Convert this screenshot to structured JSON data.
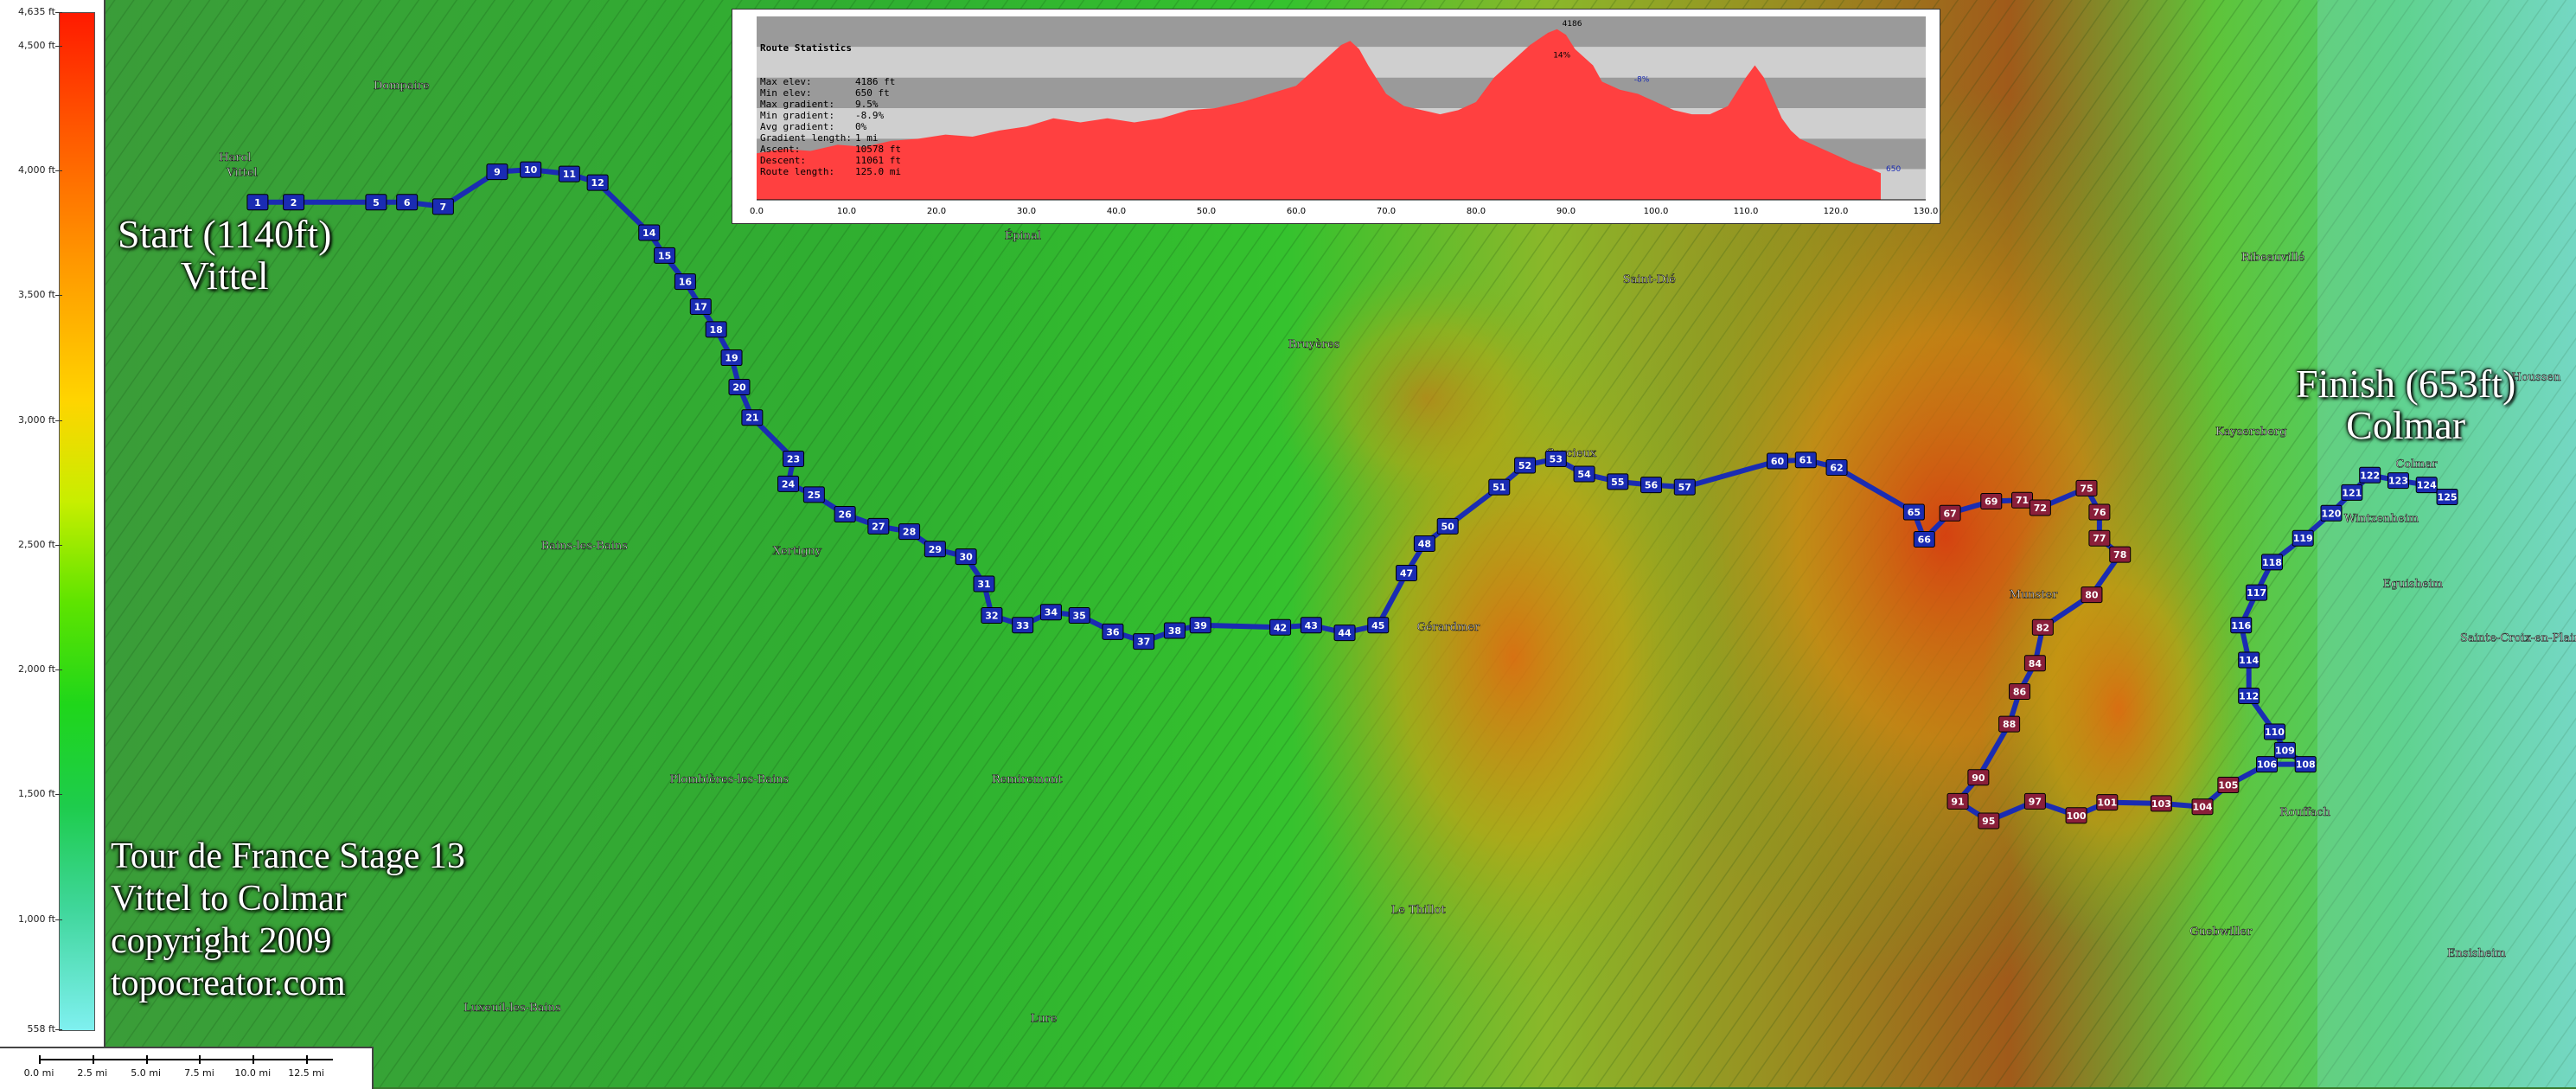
{
  "elevation_legend": {
    "ticks": [
      "4,635 ft",
      "4,500 ft",
      "4,000 ft",
      "3,500 ft",
      "3,000 ft",
      "2,500 ft",
      "2,000 ft",
      "1,500 ft",
      "1,000 ft",
      "558 ft"
    ],
    "tick_values": [
      4635,
      4500,
      4000,
      3500,
      3000,
      2500,
      2000,
      1500,
      1000,
      558
    ]
  },
  "scale": {
    "labels": [
      "0.0 mi",
      "2.5 mi",
      "5.0 mi",
      "7.5 mi",
      "10.0 mi",
      "12.5 mi"
    ]
  },
  "start_label": {
    "line1": "Start (1140ft)",
    "line2": "Vittel"
  },
  "finish_label": {
    "line1": "Finish (653ft)",
    "line2": "Colmar"
  },
  "info": {
    "line1": "Tour de France Stage 13",
    "line2": "Vittel to Colmar",
    "line3": "copyright 2009",
    "line4": "topocreator.com"
  },
  "route_stats": {
    "title": "Route Statistics",
    "rows": [
      {
        "label": "Max elev:",
        "value": "4186 ft"
      },
      {
        "label": "Min elev:",
        "value": "650 ft"
      },
      {
        "label": "Max gradient:",
        "value": "9.5%"
      },
      {
        "label": "Min gradient:",
        "value": "-8.9%"
      },
      {
        "label": "Avg gradient:",
        "value": "0%"
      },
      {
        "label": "Gradient length:",
        "value": "1 mi"
      },
      {
        "label": "Ascent:",
        "value": "10578 ft"
      },
      {
        "label": "Descent:",
        "value": "11061 ft"
      },
      {
        "label": "Route length:",
        "value": "125.0 mi"
      }
    ],
    "annotations": [
      "4186",
      "14%",
      "-8%",
      "650"
    ]
  },
  "chart_data": {
    "type": "area",
    "x_tick_labels": [
      "0.0",
      "10.0",
      "20.0",
      "30.0",
      "40.0",
      "50.0",
      "60.0",
      "70.0",
      "80.0",
      "90.0",
      "100.0",
      "110.0",
      "120.0",
      "130.0"
    ],
    "xlim": [
      0,
      130
    ],
    "ylim": [
      0,
      4500
    ],
    "x": [
      0,
      3,
      6,
      9,
      12,
      15,
      18,
      21,
      24,
      27,
      30,
      33,
      36,
      39,
      42,
      45,
      48,
      51,
      54,
      57,
      60,
      62,
      64,
      65,
      66,
      67,
      68,
      70,
      72,
      74,
      76,
      78,
      80,
      82,
      84,
      86,
      88,
      89,
      90,
      91,
      92,
      93,
      94,
      96,
      98,
      100,
      102,
      104,
      106,
      108,
      110,
      111,
      112,
      113,
      114,
      115,
      116,
      118,
      120,
      122,
      124,
      125
    ],
    "y": [
      1140,
      1250,
      1200,
      1350,
      1300,
      1450,
      1500,
      1600,
      1550,
      1700,
      1800,
      2000,
      1900,
      2000,
      1900,
      2000,
      2200,
      2250,
      2400,
      2600,
      2800,
      3200,
      3600,
      3800,
      3900,
      3700,
      3300,
      2600,
      2300,
      2200,
      2100,
      2200,
      2400,
      3000,
      3400,
      3800,
      4100,
      4186,
      4050,
      3700,
      3500,
      3300,
      2900,
      2700,
      2600,
      2400,
      2200,
      2100,
      2100,
      2300,
      3000,
      3300,
      3000,
      2500,
      2000,
      1700,
      1500,
      1300,
      1100,
      900,
      750,
      653
    ],
    "series_color": "#ff4040",
    "bands": [
      "#9a9a9a",
      "#cfcfcf"
    ]
  },
  "route": {
    "color": "#1a2cb3",
    "markers": [
      {
        "n": "1",
        "mx": 0.1,
        "my": 0.186
      },
      {
        "n": "2",
        "mx": 0.114,
        "my": 0.186
      },
      {
        "n": "5",
        "mx": 0.146,
        "my": 0.186
      },
      {
        "n": "6",
        "mx": 0.158,
        "my": 0.186
      },
      {
        "n": "7",
        "mx": 0.172,
        "my": 0.19
      },
      {
        "n": "9",
        "mx": 0.193,
        "my": 0.158
      },
      {
        "n": "10",
        "mx": 0.206,
        "my": 0.156
      },
      {
        "n": "11",
        "mx": 0.221,
        "my": 0.16
      },
      {
        "n": "12",
        "mx": 0.232,
        "my": 0.168
      },
      {
        "n": "14",
        "mx": 0.252,
        "my": 0.214
      },
      {
        "n": "15",
        "mx": 0.258,
        "my": 0.235
      },
      {
        "n": "16",
        "mx": 0.266,
        "my": 0.259
      },
      {
        "n": "17",
        "mx": 0.272,
        "my": 0.282
      },
      {
        "n": "18",
        "mx": 0.278,
        "my": 0.303
      },
      {
        "n": "19",
        "mx": 0.284,
        "my": 0.329
      },
      {
        "n": "20",
        "mx": 0.287,
        "my": 0.356
      },
      {
        "n": "21",
        "mx": 0.292,
        "my": 0.384
      },
      {
        "n": "23",
        "mx": 0.308,
        "my": 0.422
      },
      {
        "n": "24",
        "mx": 0.306,
        "my": 0.445
      },
      {
        "n": "25",
        "mx": 0.316,
        "my": 0.455
      },
      {
        "n": "26",
        "mx": 0.328,
        "my": 0.473
      },
      {
        "n": "27",
        "mx": 0.341,
        "my": 0.484
      },
      {
        "n": "28",
        "mx": 0.353,
        "my": 0.489
      },
      {
        "n": "29",
        "mx": 0.363,
        "my": 0.505
      },
      {
        "n": "30",
        "mx": 0.375,
        "my": 0.512
      },
      {
        "n": "31",
        "mx": 0.382,
        "my": 0.537
      },
      {
        "n": "32",
        "mx": 0.385,
        "my": 0.566
      },
      {
        "n": "33",
        "mx": 0.397,
        "my": 0.575
      },
      {
        "n": "34",
        "mx": 0.408,
        "my": 0.563
      },
      {
        "n": "35",
        "mx": 0.419,
        "my": 0.566
      },
      {
        "n": "36",
        "mx": 0.432,
        "my": 0.581
      },
      {
        "n": "37",
        "mx": 0.444,
        "my": 0.59
      },
      {
        "n": "38",
        "mx": 0.456,
        "my": 0.58
      },
      {
        "n": "39",
        "mx": 0.466,
        "my": 0.575
      },
      {
        "n": "42",
        "mx": 0.497,
        "my": 0.577
      },
      {
        "n": "43",
        "mx": 0.509,
        "my": 0.575
      },
      {
        "n": "44",
        "mx": 0.522,
        "my": 0.582
      },
      {
        "n": "45",
        "mx": 0.535,
        "my": 0.575
      },
      {
        "n": "47",
        "mx": 0.546,
        "my": 0.527
      },
      {
        "n": "48",
        "mx": 0.553,
        "my": 0.5
      },
      {
        "n": "50",
        "mx": 0.562,
        "my": 0.484
      },
      {
        "n": "51",
        "mx": 0.582,
        "my": 0.448
      },
      {
        "n": "52",
        "mx": 0.592,
        "my": 0.428
      },
      {
        "n": "53",
        "mx": 0.604,
        "my": 0.422
      },
      {
        "n": "54",
        "mx": 0.615,
        "my": 0.436
      },
      {
        "n": "55",
        "mx": 0.628,
        "my": 0.443
      },
      {
        "n": "56",
        "mx": 0.641,
        "my": 0.446
      },
      {
        "n": "57",
        "mx": 0.654,
        "my": 0.448
      },
      {
        "n": "60",
        "mx": 0.69,
        "my": 0.424
      },
      {
        "n": "61",
        "mx": 0.701,
        "my": 0.423
      },
      {
        "n": "62",
        "mx": 0.713,
        "my": 0.43
      },
      {
        "n": "65",
        "mx": 0.743,
        "my": 0.471
      },
      {
        "n": "66",
        "mx": 0.747,
        "my": 0.496
      },
      {
        "n": "67",
        "mx": 0.757,
        "my": 0.472
      },
      {
        "n": "69",
        "mx": 0.773,
        "my": 0.461
      },
      {
        "n": "71",
        "mx": 0.785,
        "my": 0.46
      },
      {
        "n": "72",
        "mx": 0.792,
        "my": 0.467
      },
      {
        "n": "75",
        "mx": 0.81,
        "my": 0.449
      },
      {
        "n": "76",
        "mx": 0.815,
        "my": 0.471
      },
      {
        "n": "77",
        "mx": 0.815,
        "my": 0.495
      },
      {
        "n": "78",
        "mx": 0.823,
        "my": 0.51
      },
      {
        "n": "80",
        "mx": 0.812,
        "my": 0.547
      },
      {
        "n": "82",
        "mx": 0.793,
        "my": 0.577
      },
      {
        "n": "84",
        "mx": 0.79,
        "my": 0.61
      },
      {
        "n": "86",
        "mx": 0.784,
        "my": 0.636
      },
      {
        "n": "88",
        "mx": 0.78,
        "my": 0.666
      },
      {
        "n": "90",
        "mx": 0.768,
        "my": 0.715
      },
      {
        "n": "91",
        "mx": 0.76,
        "my": 0.737
      },
      {
        "n": "95",
        "mx": 0.772,
        "my": 0.755
      },
      {
        "n": "97",
        "mx": 0.79,
        "my": 0.737
      },
      {
        "n": "100",
        "mx": 0.806,
        "my": 0.75
      },
      {
        "n": "101",
        "mx": 0.818,
        "my": 0.738
      },
      {
        "n": "103",
        "mx": 0.839,
        "my": 0.739
      },
      {
        "n": "104",
        "mx": 0.855,
        "my": 0.742
      },
      {
        "n": "105",
        "mx": 0.865,
        "my": 0.722
      },
      {
        "n": "106",
        "mx": 0.88,
        "my": 0.703
      },
      {
        "n": "108",
        "mx": 0.895,
        "my": 0.703
      },
      {
        "n": "109",
        "mx": 0.887,
        "my": 0.69
      },
      {
        "n": "110",
        "mx": 0.883,
        "my": 0.673
      },
      {
        "n": "112",
        "mx": 0.873,
        "my": 0.64
      },
      {
        "n": "114",
        "mx": 0.873,
        "my": 0.607
      },
      {
        "n": "116",
        "mx": 0.87,
        "my": 0.575
      },
      {
        "n": "117",
        "mx": 0.876,
        "my": 0.545
      },
      {
        "n": "118",
        "mx": 0.882,
        "my": 0.517
      },
      {
        "n": "119",
        "mx": 0.894,
        "my": 0.495
      },
      {
        "n": "120",
        "mx": 0.905,
        "my": 0.472
      },
      {
        "n": "121",
        "mx": 0.913,
        "my": 0.453
      },
      {
        "n": "122",
        "mx": 0.92,
        "my": 0.437
      },
      {
        "n": "123",
        "mx": 0.931,
        "my": 0.442
      },
      {
        "n": "124",
        "mx": 0.942,
        "my": 0.446
      },
      {
        "n": "125",
        "mx": 0.95,
        "my": 0.457
      }
    ]
  },
  "towns": [
    {
      "name": "Vittel",
      "mx": 0.088,
      "my": 0.162
    },
    {
      "name": "Harol",
      "mx": 0.085,
      "my": 0.148
    },
    {
      "name": "Dompaire",
      "mx": 0.145,
      "my": 0.082
    },
    {
      "name": "Bains-les-Bains",
      "mx": 0.21,
      "my": 0.505
    },
    {
      "name": "Xertigny",
      "mx": 0.3,
      "my": 0.51
    },
    {
      "name": "Remiremont",
      "mx": 0.385,
      "my": 0.72
    },
    {
      "name": "Épinal",
      "mx": 0.39,
      "my": 0.22
    },
    {
      "name": "Gérardmer",
      "mx": 0.55,
      "my": 0.58
    },
    {
      "name": "Le Thillot",
      "mx": 0.54,
      "my": 0.84
    },
    {
      "name": "Saint-Dié",
      "mx": 0.63,
      "my": 0.26
    },
    {
      "name": "Munster",
      "mx": 0.78,
      "my": 0.55
    },
    {
      "name": "Guebwiller",
      "mx": 0.85,
      "my": 0.86
    },
    {
      "name": "Rouffach",
      "mx": 0.885,
      "my": 0.75
    },
    {
      "name": "Eguisheim",
      "mx": 0.925,
      "my": 0.54
    },
    {
      "name": "Wintzenheim",
      "mx": 0.91,
      "my": 0.48
    },
    {
      "name": "Houssen",
      "mx": 0.975,
      "my": 0.35
    },
    {
      "name": "Sainte-Croix-en-Plaine",
      "mx": 0.955,
      "my": 0.59
    },
    {
      "name": "Ensisheim",
      "mx": 0.95,
      "my": 0.88
    },
    {
      "name": "Lure",
      "mx": 0.4,
      "my": 0.94
    },
    {
      "name": "Luxeuil-les-Bains",
      "mx": 0.18,
      "my": 0.93
    },
    {
      "name": "Plombières-les-Bains",
      "mx": 0.26,
      "my": 0.72
    },
    {
      "name": "Bruyères",
      "mx": 0.5,
      "my": 0.32
    },
    {
      "name": "Corcieux",
      "mx": 0.6,
      "my": 0.42
    },
    {
      "name": "Kaysersberg",
      "mx": 0.86,
      "my": 0.4
    },
    {
      "name": "Ribeauvillé",
      "mx": 0.87,
      "my": 0.24
    },
    {
      "name": "Colmar",
      "mx": 0.93,
      "my": 0.43
    }
  ]
}
